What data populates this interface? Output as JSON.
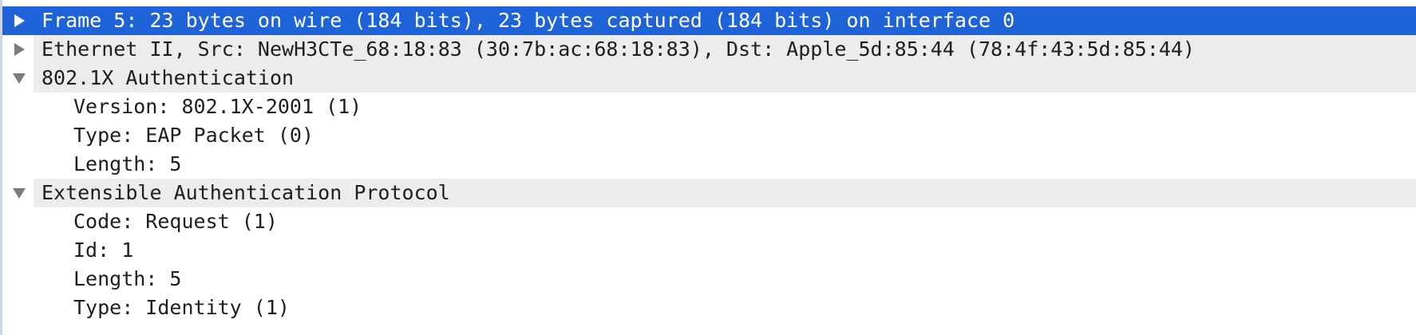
{
  "packet_details": {
    "rows": [
      {
        "label": "Frame 5: 23 bytes on wire (184 bits), 23 bytes captured (184 bits) on interface 0",
        "expanded": false,
        "selected": true
      },
      {
        "label": "Ethernet II, Src: NewH3CTe_68:18:83 (30:7b:ac:68:18:83), Dst: Apple_5d:85:44 (78:4f:43:5d:85:44)",
        "expanded": false
      },
      {
        "label": "802.1X Authentication",
        "expanded": true,
        "children": [
          "Version: 802.1X-2001 (1)",
          "Type: EAP Packet (0)",
          "Length: 5"
        ]
      },
      {
        "label": "Extensible Authentication Protocol",
        "expanded": true,
        "children": [
          "Code: Request (1)",
          "Id: 1",
          "Length: 5",
          "Type: Identity (1)"
        ]
      }
    ]
  },
  "colors": {
    "selection": "#1f63d8",
    "header_band": "#ececec",
    "expander": "#7a7a7a"
  }
}
